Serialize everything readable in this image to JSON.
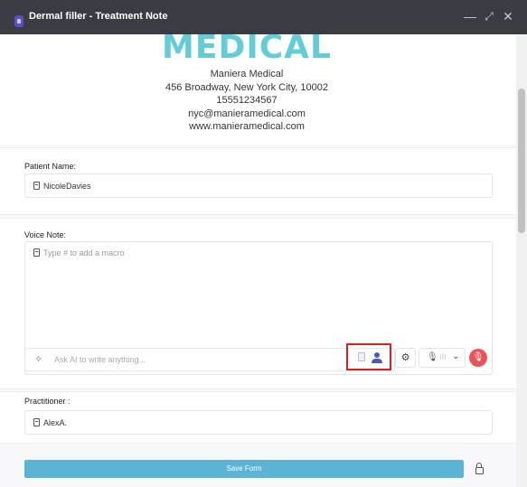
{
  "window": {
    "title": "Dermal filler - Treatment Note",
    "controls": {
      "minimize": "—",
      "maximize": "⤢",
      "close": "✕"
    }
  },
  "header": {
    "logo_text": "MEDICAL",
    "clinic_name": "Maniera Medical",
    "address": "456 Broadway, New York City, 10002",
    "phone": "15551234567",
    "email": "nyc@manieramedical.com",
    "website": "www.manieramedical.com"
  },
  "patient": {
    "label": "Patient Name:",
    "value": "NicoleDavies"
  },
  "voice_note": {
    "label": "Voice Note:",
    "placeholder": "Type # to add a macro",
    "ai_placeholder": "Ask AI to write anything...",
    "icons": [
      "sparkle-icon",
      "document-icon",
      "user-icon",
      "gear-icon",
      "microphone-icon",
      "chevron-down-icon",
      "record-microphone-icon"
    ]
  },
  "practitioner": {
    "label": "Practitioner :",
    "value": "AlexA."
  },
  "footer": {
    "save_label": "Save Form",
    "lock_icon": "lock-icon"
  },
  "colors": {
    "titlebar": "#3b3b44",
    "logo": "#65ccd6",
    "save_button": "#5bb4d3",
    "record_button": "#e8545c",
    "highlight_box": "#d81f26"
  }
}
